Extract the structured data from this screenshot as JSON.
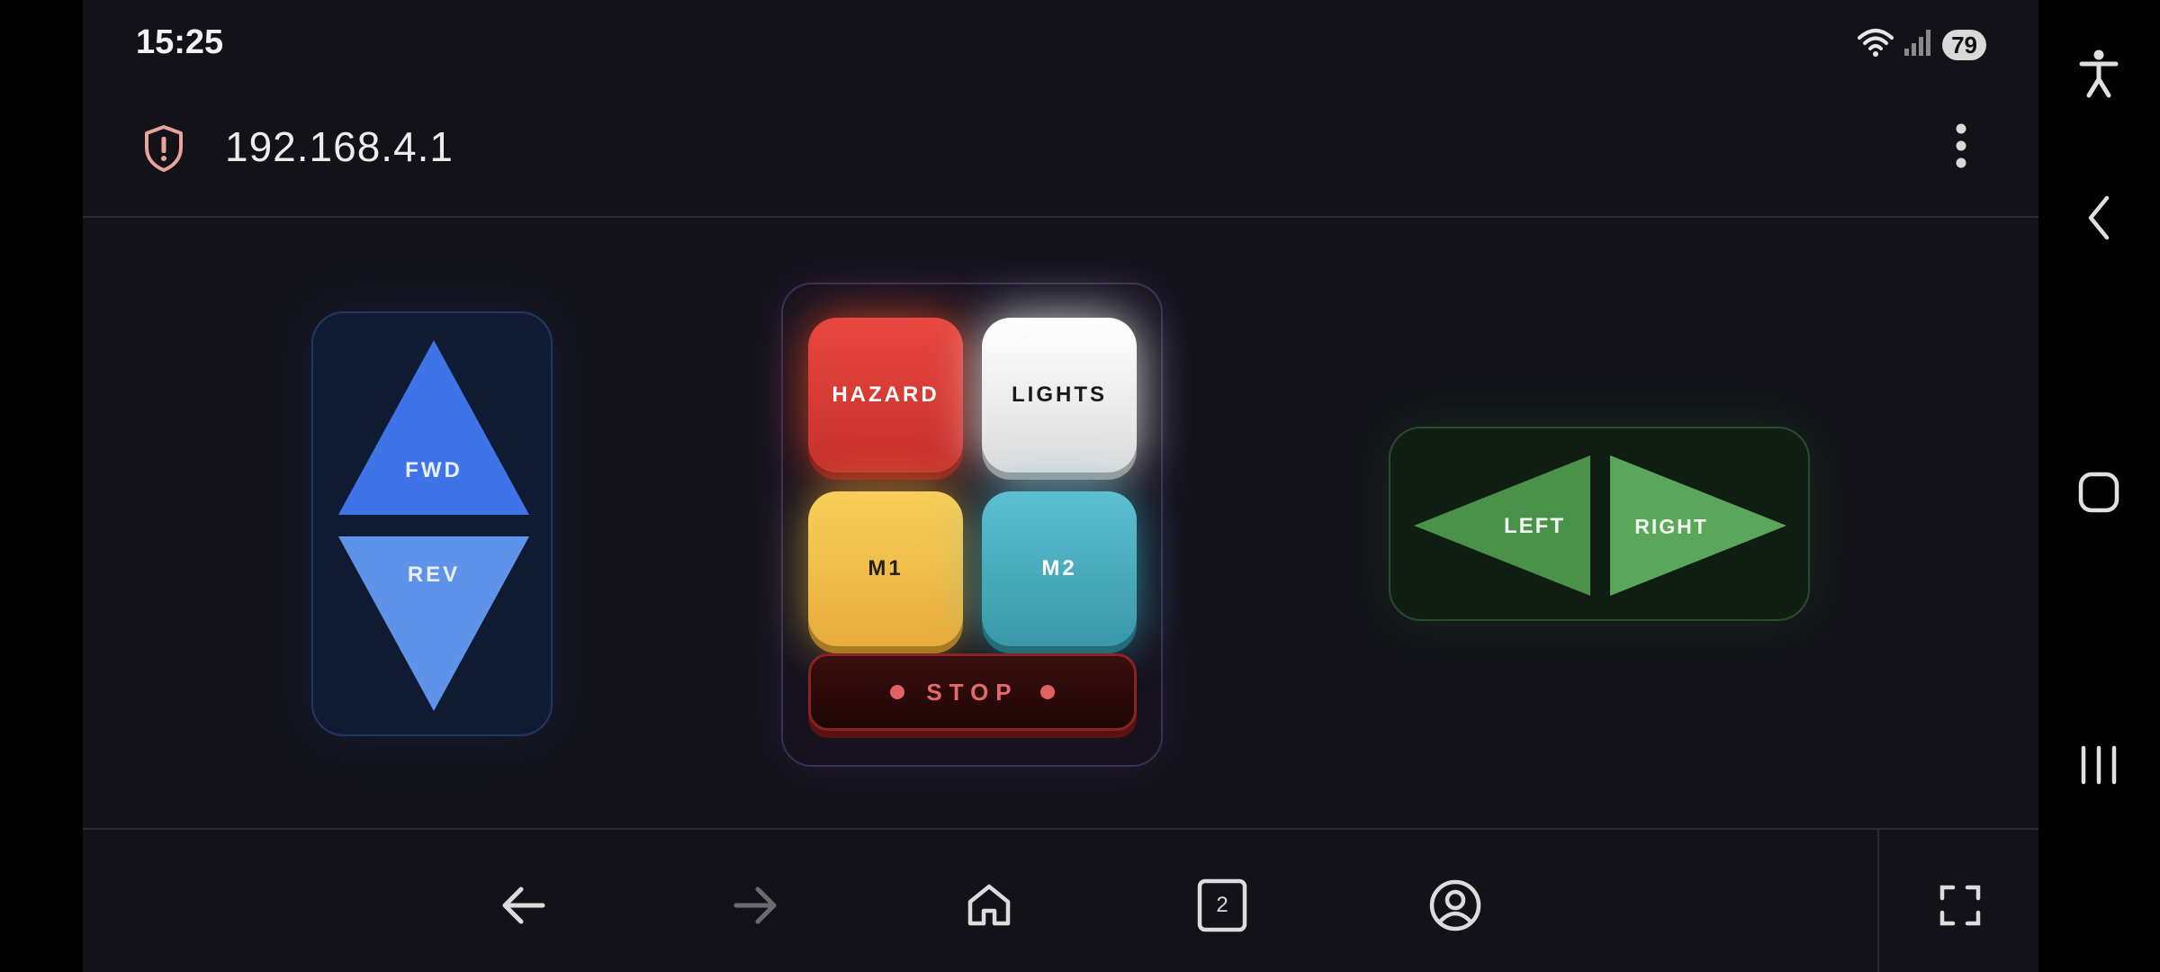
{
  "status_bar": {
    "time": "15:25",
    "battery": "79"
  },
  "browser": {
    "url": "192.168.4.1",
    "tabs_count": "2"
  },
  "controls": {
    "dpad": {
      "forward_label": "FWD",
      "reverse_label": "REV"
    },
    "buttons": {
      "hazard": "HAZARD",
      "lights": "LIGHTS",
      "m1": "M1",
      "m2": "M2",
      "stop": "STOP"
    },
    "steering": {
      "left_label": "LEFT",
      "right_label": "RIGHT"
    }
  },
  "colors": {
    "hazard": "#d63b34",
    "lights": "#f2f2f2",
    "m1": "#f2c250",
    "m2": "#4cb1c3",
    "forward": "#3f74e8",
    "reverse": "#5f93ea",
    "steer": "#4f9b4f",
    "stop": "#8c2222"
  },
  "icons": {
    "url_bar": [
      "shield-alert-icon",
      "more-vert-icon"
    ],
    "toolbar": [
      "arrow-back-icon",
      "arrow-forward-icon",
      "home-icon",
      "tabs-icon",
      "account-icon",
      "fullscreen-icon"
    ],
    "nav_rail": [
      "accessibility-icon",
      "nav-back-icon",
      "nav-home-icon",
      "recents-icon"
    ]
  }
}
